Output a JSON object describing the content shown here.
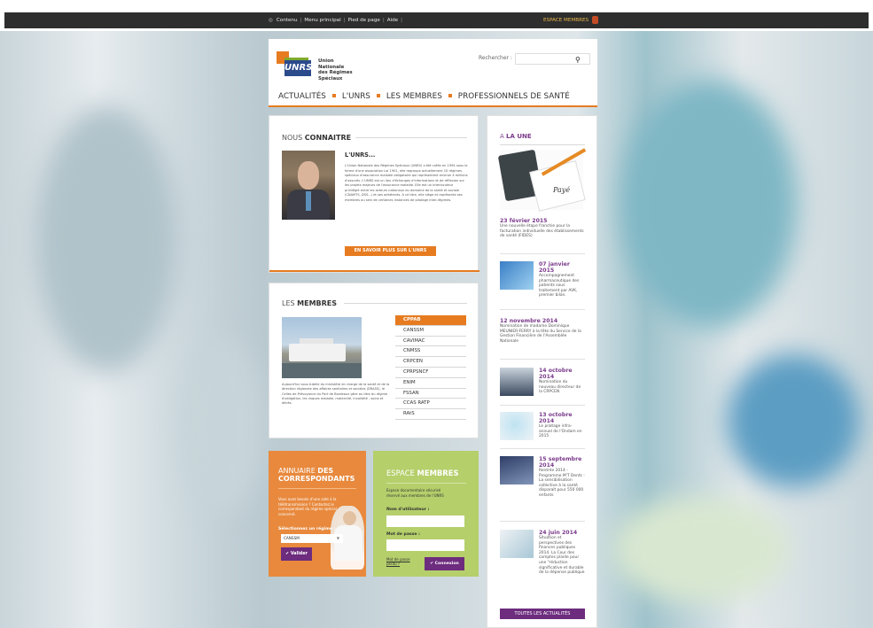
{
  "topbar": {
    "links": [
      "Contenu",
      "Menu principal",
      "Pied de page",
      "Aide"
    ],
    "members_link": "ESPACE MEMBRES"
  },
  "header": {
    "logo_text": "UNRS",
    "logo_caption": "Union Nationale des Régimes Spéciaux",
    "search_label": "Rechercher :",
    "search_placeholder": "",
    "nav": [
      "ACTUALITÉS",
      "L'UNRS",
      "LES MEMBRES",
      "PROFESSIONNELS DE SANTÉ"
    ]
  },
  "nous": {
    "title_light": "NOUS ",
    "title_bold": "CONNAITRE",
    "subtitle": "L'UNRS...",
    "body": "L'Union Nationale des Régimes Spéciaux (UNRS) a été créée en 1994 sous la forme d'une association Loi 1901, elle regroupe actuellement 10 régimes spéciaux d'assurance maladie obligatoire qui représentent environ 4 millions d'assurés. L'UNRS est un lieu d'échanges d'informations et de réflexion sur les projets majeurs de l'assurance maladie. Elle est un interlocuteur privilégié entre les acteurs nationaux du domaine de la santé et sociale (CNAMTS, DSS...) et ses adhérents. A ce titre, elle siège et représente ses membres au sein de certaines instances de pilotage inter-régimes.",
    "button": "EN SAVOIR PLUS SUR L'UNRS"
  },
  "membres": {
    "title_light": "LES ",
    "title_bold": "MEMBRES",
    "description": "Aujourd'hui sous tutelle du ministère en charge de la santé et de la direction régionale des affaires sanitaires et sociales (DRASS), le Celles de Prévoyance du Port de Bordeaux gère au titre du régime d'obligation, les risques maladie, maternité, invalidité - soins et décès.",
    "list": [
      "CPPAB",
      "CANSSM",
      "CAVIMAC",
      "CNMSS",
      "CRPCEN",
      "CPRPSNCF",
      "ENIM",
      "FSSAN",
      "CCAS RATP",
      "RAtS"
    ]
  },
  "annuaire": {
    "title_light": "ANNUAIRE ",
    "title_bold1": "DES",
    "title_bold2": "CORRESPONDANTS",
    "text": "Vous avez besoin d'une aide à la télétransmission ? Contactez le correspondant du régime spécial concerné.",
    "select_label": "Sélectionnez un régime :",
    "select_value": "CANSSM",
    "button": "Valider"
  },
  "espace": {
    "title_light": "ESPACE ",
    "title_bold": "MEMBRES",
    "text": "Espace documentaire sécurisé réservé aux membres de l'UNRS",
    "user_label": "Nom d'utilisateur :",
    "user_value": "",
    "pass_label": "Mot de passe :",
    "pass_value": "",
    "forgot": "Mot de passe perdu ?",
    "button": "Connexion"
  },
  "une": {
    "title_light": "A ",
    "title_bold": "LA UNE",
    "image_label": "Payé",
    "news": [
      {
        "date": "23 février 2015",
        "text": "Une nouvelle étape franchie pour la facturation individuelle des établissements de santé (FIDES)"
      },
      {
        "date": "07 janvier 2015",
        "text": "Accompagnement pharmaceutique des patients sous traitement par AVK, premier bilan."
      },
      {
        "date": "12 novembre 2014",
        "text": "Nomination de madame Dominique MEUNIER-FERRY à la tête du Service de la Gestion Financière de l'Assemblée Nationale"
      },
      {
        "date": "14 octobre 2014",
        "text": "Nomination du nouveau directeur de la CRPCEN"
      },
      {
        "date": "13 octobre 2014",
        "text": "Le pilotage infra-annuel de l'Ondam en 2015"
      },
      {
        "date": "15 septembre 2014",
        "text": "Rentrée 2014 - Programme M'T Dents : La sensibilisation collective à la santé disparaît pour 550 000 enfants"
      },
      {
        "date": "24 juin 2014",
        "text": "Situation et perspectives des finances publiques 2014. La Cour des comptes plaide pour une \"réduction significative et durable de la dépense publique"
      }
    ],
    "button": "TOUTES LES ACTUALITÉS"
  },
  "colors": {
    "accent_orange": "#e67b20",
    "purple": "#6d2c7e",
    "green": "#b5cf6b"
  }
}
